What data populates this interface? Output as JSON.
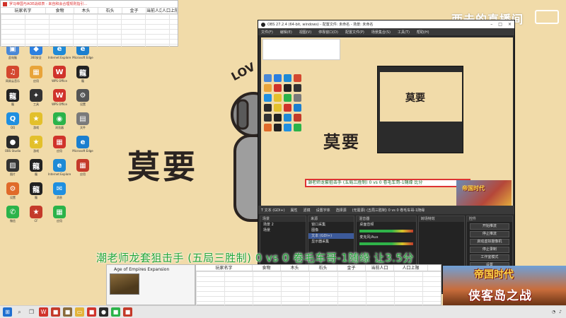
{
  "watermark": "西去的直播间",
  "top_sheet": {
    "title": "罗马帝国与AOE战绩表 - 来自和会合理规则指引…",
    "columns": [
      "玩家名字",
      "食物",
      "木头",
      "石头",
      "金子",
      "当前人口",
      "人口上限"
    ]
  },
  "desktop": {
    "icons": [
      {
        "label": "此电脑",
        "icon": "computer-icon",
        "color": "#4a88d6"
      },
      {
        "label": "360安全",
        "icon": "shield-icon",
        "color": "#2b7fe0"
      },
      {
        "label": "Internet Explorer",
        "icon": "ie-icon",
        "color": "#1e8ad6"
      },
      {
        "label": "Microsoft Edge",
        "icon": "edge-icon",
        "color": "#1b7fcf"
      },
      {
        "label": "网易云音乐",
        "icon": "music-icon",
        "color": "#d4482f"
      },
      {
        "label": "应用",
        "icon": "apps-icon",
        "color": "#e8a43a"
      },
      {
        "label": "WPS Office",
        "icon": "wps-icon",
        "color": "#d0332b"
      },
      {
        "label": "龍",
        "icon": "dragon-icon",
        "color": "#222222"
      },
      {
        "label": "龍",
        "icon": "dragon-icon",
        "color": "#222222"
      },
      {
        "label": "工具",
        "icon": "tool-icon",
        "color": "#333333"
      },
      {
        "label": "WPS Office",
        "icon": "wps-icon",
        "color": "#d0332b"
      },
      {
        "label": "设置",
        "icon": "gear-icon",
        "color": "#555555"
      },
      {
        "label": "QQ",
        "icon": "qq-icon",
        "color": "#1f8fe0"
      },
      {
        "label": "游戏",
        "icon": "game-icon",
        "color": "#e3c02b"
      },
      {
        "label": "浏览器",
        "icon": "browser-icon",
        "color": "#2bb34a"
      },
      {
        "label": "文件",
        "icon": "file-icon",
        "color": "#7a7a7a"
      },
      {
        "label": "OBS Studio",
        "icon": "obs-icon",
        "color": "#2a2a2a"
      },
      {
        "label": "游戏",
        "icon": "game-icon",
        "color": "#e3c02b"
      },
      {
        "label": "应用",
        "icon": "apps-icon",
        "color": "#d0332b"
      },
      {
        "label": "Microsoft Edge",
        "icon": "edge-icon",
        "color": "#1b7fcf"
      },
      {
        "label": "图片",
        "icon": "image-icon",
        "color": "#333333"
      },
      {
        "label": "龍",
        "icon": "dragon-icon",
        "color": "#222222"
      },
      {
        "label": "Internet Explorer",
        "icon": "ie-icon",
        "color": "#1e8ad6"
      },
      {
        "label": "应用",
        "icon": "apps-icon",
        "color": "#c43a2a"
      },
      {
        "label": "设置",
        "icon": "gear-icon",
        "color": "#e06a2a"
      },
      {
        "label": "龍",
        "icon": "dragon-icon",
        "color": "#222222"
      },
      {
        "label": "消息",
        "icon": "chat-icon",
        "color": "#1f8fe0"
      },
      {
        "label": "",
        "icon": "blank-icon",
        "color": "#f1dba9"
      },
      {
        "label": "微信",
        "icon": "wechat-icon",
        "color": "#2bb34a"
      },
      {
        "label": "CF",
        "icon": "game-icon",
        "color": "#c43a2a"
      },
      {
        "label": "应用",
        "icon": "apps-icon",
        "color": "#2bb34a"
      },
      {
        "label": "",
        "icon": "blank-icon",
        "color": "#f1dba9"
      }
    ]
  },
  "art": {
    "name": "莫要",
    "love": "LOV"
  },
  "obs": {
    "title": "OBS 27.2.4 (64-bit, windows) - 配置文件: 未命名 - 场景: 未命名",
    "menu": [
      "文件(F)",
      "编辑(E)",
      "视图(V)",
      "停靠窗口(D)",
      "配置文件(P)",
      "场景集合(S)",
      "工具(T)",
      "帮助(H)"
    ],
    "toolbar": [
      "T  文本 (GDI+)",
      "属性",
      "滤镜",
      "设置字体",
      "选择源",
      "(无需源) (五局三胜制) 0 vs 0 卷毛车哥-1随缘"
    ],
    "preview_scroll": "潮老师龙套狙击手 (五局三胜制) 0 vs 0 卷毛车哥-1随缘 比分",
    "preview_game": "帝国时代",
    "panels": {
      "scenes_header": "场景",
      "scenes": [
        "场景 2",
        "场景"
      ],
      "sources_header": "来源",
      "sources": [
        "窗口采集",
        "图像",
        "文本 (GDI+)",
        "显示器采集"
      ],
      "mixer_header": "混音器",
      "mixer": [
        "桌面音频",
        "麦克风/Aux"
      ],
      "transitions_header": "转场特效",
      "controls_header": "控件",
      "controls": [
        "开始推流",
        "停止推流",
        "启动虚拟摄像机",
        "停止录制",
        "工作室模式",
        "设置",
        "退出"
      ]
    }
  },
  "caption": "潮老师龙套狙击手 (五局三胜制) 0 vs 0 卷毛车哥-1随缘 让3.5分",
  "aoe_popup": {
    "title": "Age of Empires Expansion"
  },
  "bottom_sheet": {
    "columns": [
      "玩家名字",
      "食物",
      "木头",
      "石头",
      "金子",
      "当前人口",
      "人口上限"
    ]
  },
  "game_banner": {
    "line1": "帝国时代",
    "line2": "侠客岛之战"
  },
  "taskbar": {
    "items": [
      {
        "icon": "start-icon",
        "color": "#1f6fd0"
      },
      {
        "icon": "search-icon",
        "color": "#555555"
      },
      {
        "icon": "task-view-icon",
        "color": "#555555"
      },
      {
        "icon": "wps-icon",
        "color": "#d0332b"
      },
      {
        "icon": "app-icon",
        "color": "#c43a2a"
      },
      {
        "icon": "app-icon",
        "color": "#8a6b3a"
      },
      {
        "icon": "folder-icon",
        "color": "#e3b43a"
      },
      {
        "icon": "app-icon",
        "color": "#d0332b"
      },
      {
        "icon": "obs-icon",
        "color": "#2a2a2a"
      },
      {
        "icon": "app-icon",
        "color": "#2bb34a"
      },
      {
        "icon": "app-icon",
        "color": "#c43a2a"
      }
    ]
  }
}
